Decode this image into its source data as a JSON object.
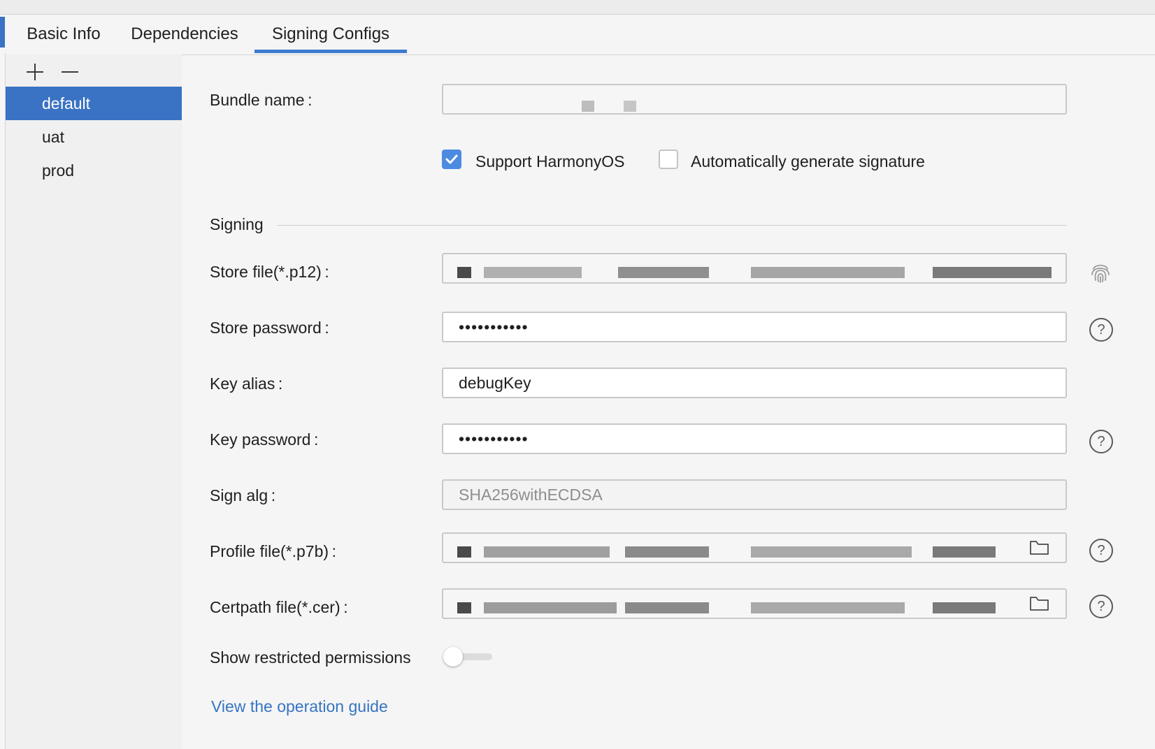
{
  "tabs": [
    {
      "label": "Basic Info"
    },
    {
      "label": "Dependencies"
    },
    {
      "label": "Signing Configs"
    }
  ],
  "sidebar": {
    "items": [
      {
        "label": "default"
      },
      {
        "label": "uat"
      },
      {
        "label": "prod"
      }
    ]
  },
  "form": {
    "bundle_name_label": "Bundle name :",
    "support_harmonyos_label": "Support HarmonyOS",
    "support_harmonyos_checked": true,
    "auto_sign_label": "Automatically generate signature",
    "auto_sign_checked": false,
    "signing_section": "Signing",
    "store_file_label": "Store file(*.p12) :",
    "store_password_label": "Store password :",
    "store_password_value": "•••••••••••",
    "key_alias_label": "Key alias :",
    "key_alias_value": "debugKey",
    "key_password_label": "Key password :",
    "key_password_value": "•••••••••••",
    "sign_alg_label": "Sign alg :",
    "sign_alg_value": "SHA256withECDSA",
    "profile_file_label": "Profile file(*.p7b) :",
    "certpath_file_label": "Certpath file(*.cer) :",
    "restricted_label": "Show restricted permissions",
    "restricted_on": false,
    "guide_link": "View the operation guide"
  },
  "colors": {
    "accent": "#3a72c4",
    "link": "#3574c2",
    "checkbox_on": "#4d8be0"
  },
  "icons": {
    "help": "question-circle-icon",
    "fingerprint": "fingerprint-icon",
    "folder": "folder-icon",
    "add": "plus-icon",
    "remove": "minus-icon"
  }
}
